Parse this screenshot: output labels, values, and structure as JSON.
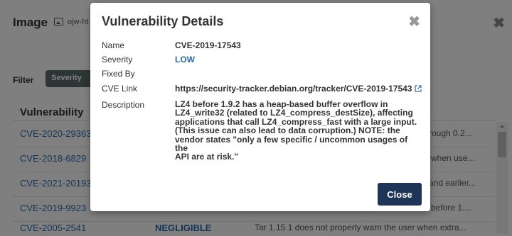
{
  "background": {
    "title": "Image",
    "image_name": "ojw-ht",
    "filter_label": "Filter",
    "filter_chip": "Severity",
    "column_header": "Vulnerability",
    "rows": [
      {
        "cve": "CVE-2020-29363",
        "severity": "",
        "desc": "rough 0.2..."
      },
      {
        "cve": "CVE-2018-6829",
        "severity": "",
        "desc": "when use..."
      },
      {
        "cve": "CVE-2021-20193",
        "severity": "",
        "desc": "and earlier..."
      },
      {
        "cve": "CVE-2019-9923",
        "severity": "",
        "desc": "before 1...."
      },
      {
        "cve": "CVE-2005-2541",
        "severity": "NEGLIGIBLE",
        "desc": "Tar 1.15.1 does not properly warn the user when extra..."
      }
    ]
  },
  "modal": {
    "title": "Vulnerability Details",
    "close_button": "Close",
    "fields": {
      "name_label": "Name",
      "name_value": "CVE-2019-17543",
      "severity_label": "Severity",
      "severity_value": "LOW",
      "fixed_by_label": "Fixed By",
      "fixed_by_value": "",
      "cve_link_label": "CVE Link",
      "cve_link_value": "https://security-tracker.debian.org/tracker/CVE-2019-17543",
      "description_label": "Description",
      "description_value": "LZ4 before 1.9.2 has a heap-based buffer overflow in\nLZ4_write32 (related to LZ4_compress_destSize), affecting\napplications that call LZ4_compress_fast with a large input.\n(This issue can also lead to data corruption.) NOTE: the\nvendor states \"only a few specific / uncommon usages of the\nAPI are at risk.\""
    }
  },
  "colors": {
    "link": "#2c6bab",
    "primary_button": "#1f3558",
    "overlay": "rgba(0,0,0,0.5)"
  },
  "icons": {
    "modal_close": "close-icon",
    "external_link": "external-link-icon",
    "image": "image-icon"
  }
}
